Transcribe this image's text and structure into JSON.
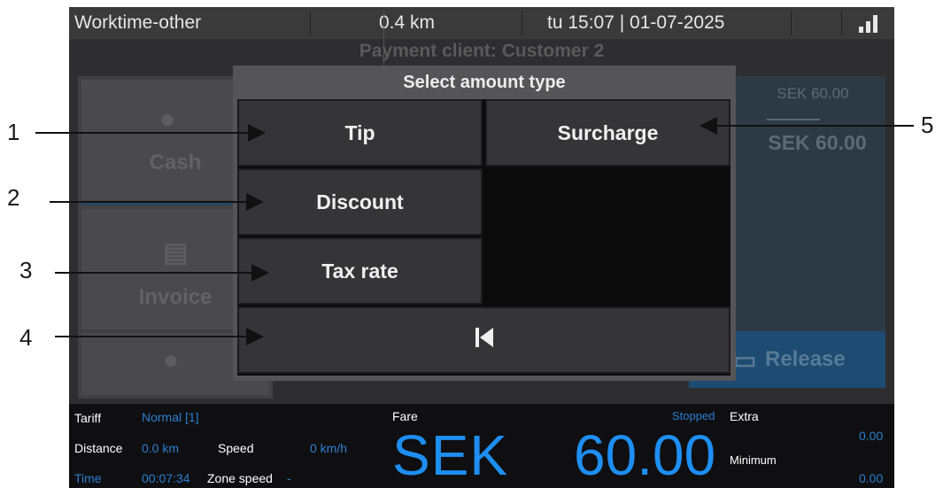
{
  "status_bar": {
    "mode": "Worktime-other",
    "distance": "0.4 km",
    "datetime": "tu 15:07 | 01-07-2025",
    "signal_icon": "signal-bars-icon"
  },
  "background": {
    "payment_client": "Payment client: Customer 2",
    "cash_label": "Cash",
    "invoice_label": "Invoice",
    "amount_small": "SEK 60.00",
    "amount_large": "SEK 60.00",
    "release_label": "Release"
  },
  "modal": {
    "title": "Select amount type",
    "tip_label": "Tip",
    "surcharge_label": "Surcharge",
    "discount_label": "Discount",
    "taxrate_label": "Tax rate",
    "back_icon": "skip-back-icon"
  },
  "info": {
    "tariff_label": "Tariff",
    "tariff_value": "Normal [1]",
    "distance_label": "Distance",
    "distance_value": "0.0 km",
    "speed_label": "Speed",
    "speed_value": "0 km/h",
    "time_label": "Time",
    "time_value": "00:07:34",
    "zone_speed_label": "Zone speed",
    "zone_speed_value": "-",
    "fare_label": "Fare",
    "stopped_label": "Stopped",
    "currency": "SEK",
    "fare_amount": "60.00",
    "extra_label": "Extra",
    "extra_value": "0.00",
    "minimum_label": "Minimum",
    "minimum_value": "0.00"
  },
  "callouts": [
    "1",
    "2",
    "3",
    "4",
    "5"
  ],
  "colors": {
    "accent_blue": "#1e8ef2",
    "modal_button": "#353538",
    "release_blue": "#1e4b71"
  }
}
